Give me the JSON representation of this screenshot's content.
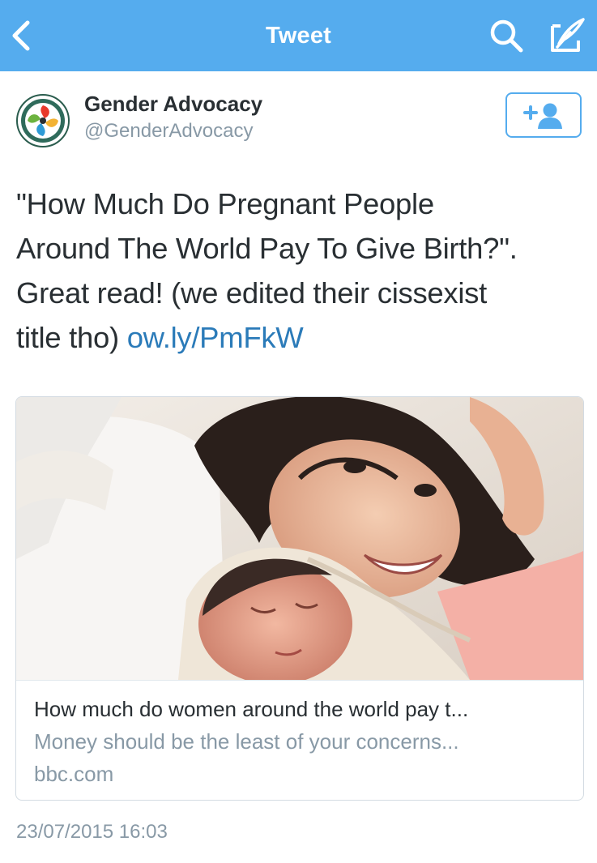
{
  "nav": {
    "title": "Tweet",
    "back_icon": "chevron-left-icon",
    "search_icon": "search-icon",
    "compose_icon": "compose-icon",
    "bar_color": "#55acee"
  },
  "author": {
    "name": "Gender Advocacy",
    "handle": "@GenderAdvocacy",
    "avatar_icon": "gender-advocacy-logo",
    "follow_icon": "follow-user-icon"
  },
  "tweet": {
    "text": "\"How Much Do Pregnant People\nAround The World Pay To Give Birth?\".\nGreat read! (we edited their cissexist\ntitle tho) ",
    "link": "ow.ly/PmFkW",
    "link_color": "#2b7bb9"
  },
  "card": {
    "image": "photo-mother-with-newborn",
    "title": "How much do women around the world pay t...",
    "description": "Money should be the least of your concerns...",
    "domain": "bbc.com"
  },
  "timestamp": "23/07/2015 16:03"
}
